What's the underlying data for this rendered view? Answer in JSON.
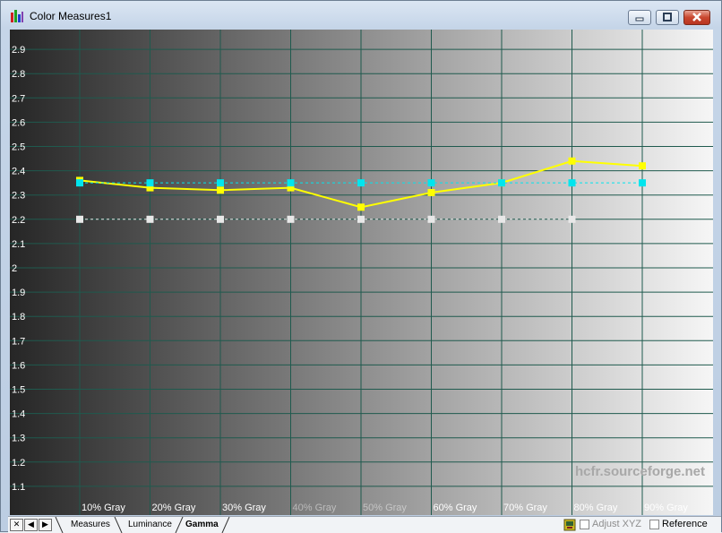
{
  "window": {
    "title": "Color Measures1",
    "icon": "bar-chart-icon"
  },
  "chart_data": {
    "type": "line",
    "categories": [
      "10% Gray",
      "20% Gray",
      "30% Gray",
      "40% Gray",
      "50% Gray",
      "60% Gray",
      "70% Gray",
      "80% Gray",
      "90% Gray"
    ],
    "yticks": [
      "2.9",
      "2.8",
      "2.7",
      "2.6",
      "2.5",
      "2.4",
      "2.3",
      "2.2",
      "2.1",
      "2",
      "1.9",
      "1.8",
      "1.7",
      "1.6",
      "1.5",
      "1.4",
      "1.3",
      "1.2",
      "1.1"
    ],
    "ylim": [
      1.0,
      3.0
    ],
    "grid": true,
    "series": [
      {
        "color": "#ffff00",
        "style": "solid",
        "marker": "square",
        "values": [
          2.36,
          2.33,
          2.32,
          2.33,
          2.25,
          2.31,
          2.35,
          2.44,
          2.42
        ]
      },
      {
        "color": "#00e5ee",
        "style": "dashed",
        "marker": "square",
        "values": [
          2.35,
          2.35,
          2.35,
          2.35,
          2.35,
          2.35,
          2.35,
          2.35,
          2.35
        ]
      },
      {
        "color": "#e8e8e8",
        "style": "dashed",
        "marker": "square",
        "values": [
          2.2,
          2.2,
          2.2,
          2.2,
          2.2,
          2.2,
          2.2,
          2.2
        ]
      }
    ],
    "watermark": "hcfr.sourceforge.net",
    "colors": {
      "grid": "#1f5a4e",
      "tick_label": "#ffffff",
      "watermark": "#a8a8a8"
    }
  },
  "tabs": [
    {
      "label": "Measures",
      "active": false
    },
    {
      "label": "Luminance",
      "active": false
    },
    {
      "label": "Gamma",
      "active": true
    }
  ],
  "nav": {
    "close": "✕",
    "prev": "◀",
    "next": "▶"
  },
  "status": {
    "adjust_xyz_label": "Adjust XYZ",
    "adjust_xyz_checked": false,
    "adjust_xyz_enabled": false,
    "reference_label": "Reference",
    "reference_checked": false
  }
}
